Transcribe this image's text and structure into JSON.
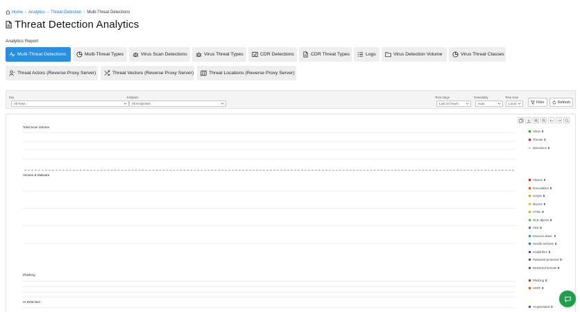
{
  "breadcrumb": {
    "items": [
      "Home",
      "Analytics",
      "Threat Detection"
    ],
    "current": "Multi-Threat Detections"
  },
  "page": {
    "title": "Threat Detection Analytics",
    "section_label": "Analytics Report"
  },
  "tabs": [
    {
      "label": "Multi-Threat Detections",
      "icon": "activity-icon",
      "active": true
    },
    {
      "label": "Multi-Threat Types",
      "icon": "pie-chart-icon",
      "active": false
    },
    {
      "label": "Virus Scan Detections",
      "icon": "bug-icon",
      "active": false
    },
    {
      "label": "Virus Threat Types",
      "icon": "bug-icon",
      "active": false
    },
    {
      "label": "CDR Detections",
      "icon": "cdr-icon",
      "active": false
    },
    {
      "label": "CDR Threat Types",
      "icon": "file-icon",
      "active": false
    },
    {
      "label": "Logs",
      "icon": "list-icon",
      "active": false
    },
    {
      "label": "Virus Detection Volume",
      "icon": "folder-icon",
      "active": false
    },
    {
      "label": "Virus Threat Classes",
      "icon": "pie-chart-icon",
      "active": false
    },
    {
      "label": "Threat Actors (Reverse Proxy Server)",
      "icon": "user-icon",
      "active": false
    },
    {
      "label": "Threat Vectors (Reverse Proxy Server)",
      "icon": "shuffle-icon",
      "active": false
    },
    {
      "label": "Threat Locations (Reverse Proxy Server)",
      "icon": "map-icon",
      "active": false
    }
  ],
  "filters": {
    "key": {
      "label": "Key",
      "value": "All Keys"
    },
    "endpoint": {
      "label": "Endpoint",
      "value": "All Endpoints"
    },
    "time_range": {
      "label": "Time range",
      "value": "Last 24 hours"
    },
    "granularity": {
      "label": "Granularity",
      "value": "Auto"
    },
    "time_zone": {
      "label": "Time zone",
      "value": "Local"
    },
    "filter_button": "Filter",
    "refresh_button": "Refresh"
  },
  "toolbar_icons": [
    "copy-icon",
    "download-icon",
    "zoom-in-icon",
    "zoom-out-icon",
    "arrow-left-icon",
    "arrow-right-icon",
    "search-icon"
  ],
  "panels": {
    "total_scan_volume": {
      "title": "Total Scan Volume",
      "legend": [
        {
          "name": "Clean",
          "value": "0",
          "color": "#2ca02c"
        },
        {
          "name": "Threats",
          "value": "0",
          "color": "#d62728"
        },
        {
          "name": "Detections",
          "value": "0",
          "color": "#f29c11"
        }
      ]
    },
    "viruses_malware": {
      "title": "Viruses & Malware",
      "legend": [
        {
          "name": "Viruses",
          "value": "0",
          "color": "#d62728"
        },
        {
          "name": "Executables",
          "value": "0",
          "color": "#e8591a"
        },
        {
          "name": "Scripts",
          "value": "0",
          "color": "#f29c11"
        },
        {
          "name": "Macros",
          "value": "0",
          "color": "#e6c01f"
        },
        {
          "name": "HTML",
          "value": "0",
          "color": "#a6c23a"
        },
        {
          "name": "OLE objects",
          "value": "0",
          "color": "#5cb85c"
        },
        {
          "name": "XXE",
          "value": "0",
          "color": "#2ca05a"
        },
        {
          "name": "Insecure deser.",
          "value": "0",
          "color": "#17a2b8"
        },
        {
          "name": "Unsafe archives",
          "value": "0",
          "color": "#1f77b4"
        },
        {
          "name": "Invalid files",
          "value": "0",
          "color": "#3f51b5"
        },
        {
          "name": "Password-protected",
          "value": "0",
          "color": "#6f42c1"
        },
        {
          "name": "Restricted formats",
          "value": "0",
          "color": "#8e44ad"
        }
      ]
    },
    "phishing": {
      "title": "Phishing",
      "legend": [
        {
          "name": "Phishing",
          "value": "0",
          "color": "#d62728"
        },
        {
          "name": "SSRF",
          "value": "0",
          "color": "#e8591a"
        }
      ]
    },
    "ai_detection": {
      "title": "AI Detection",
      "legend": [
        {
          "name": "AI-generated",
          "value": "0",
          "color": "#6f42c1"
        }
      ]
    }
  }
}
